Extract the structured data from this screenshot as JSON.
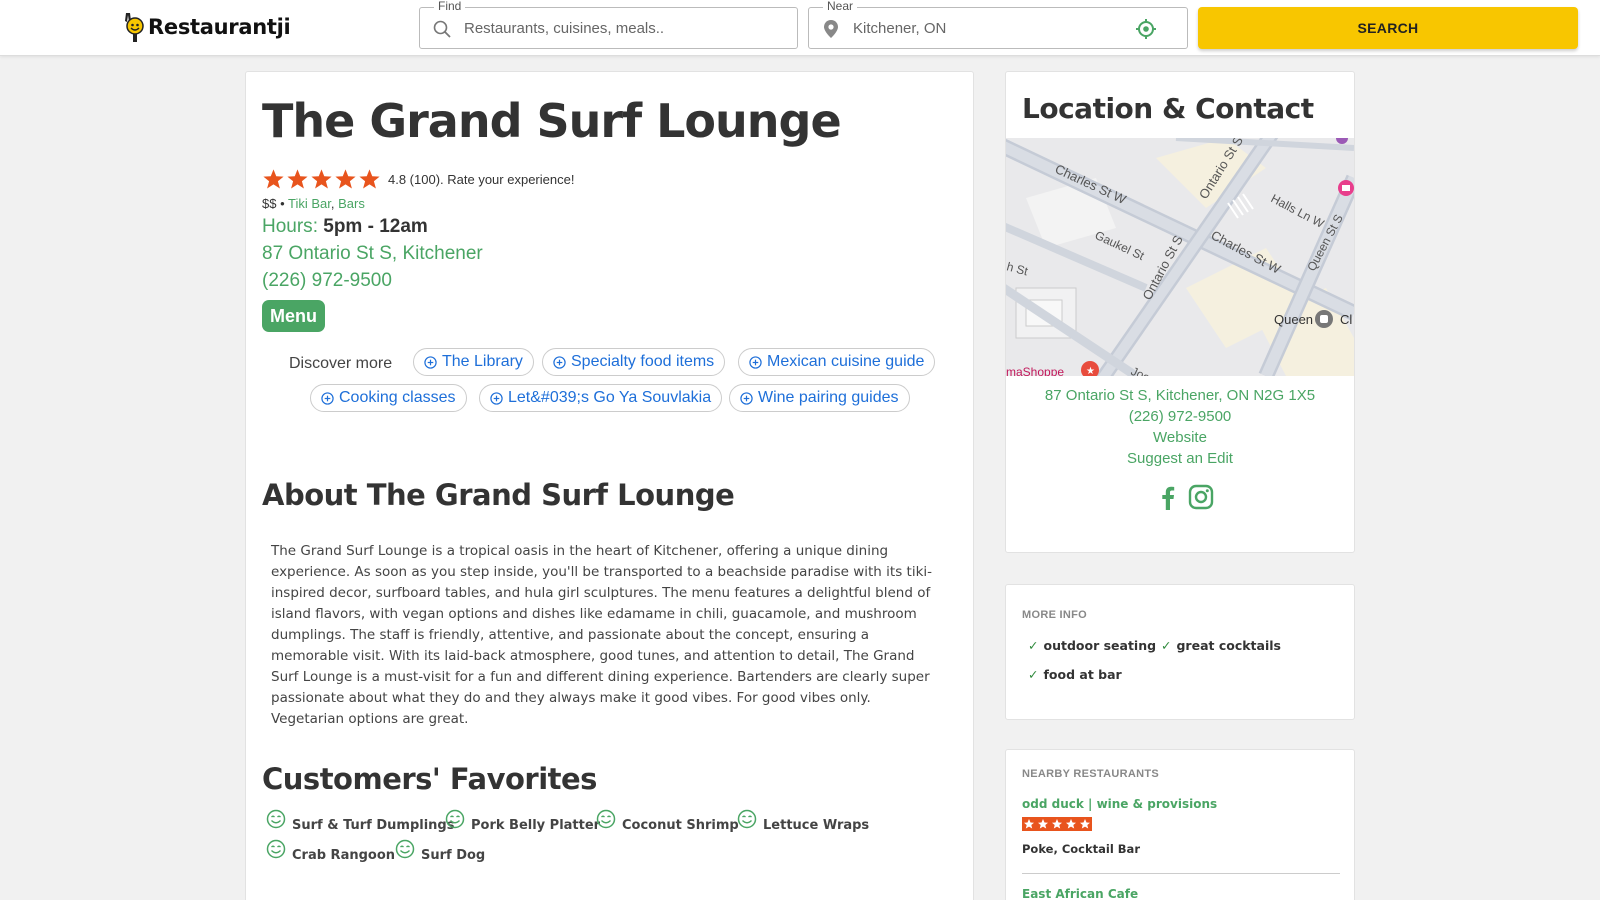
{
  "header": {
    "logo_text": "Restaurantji",
    "find_label": "Find",
    "find_placeholder": "Restaurants, cuisines, meals..",
    "near_label": "Near",
    "near_value": "Kitchener, ON",
    "search_label": "SEARCH"
  },
  "restaurant": {
    "name": "The Grand Surf Lounge",
    "rating": 4.8,
    "rating_text": "4.8 (100). Rate your experience!",
    "price": "$$",
    "separator": " • ",
    "categories": [
      "Tiki Bar",
      "Bars"
    ],
    "hours_label": "Hours",
    "hours_value": "5pm - 12am",
    "address": "87 Ontario St S, Kitchener",
    "phone": "(226) 972-9500",
    "menu_label": "Menu"
  },
  "discover": {
    "label": "Discover more",
    "chips": [
      "The Library",
      "Specialty food items",
      "Mexican cuisine guide",
      "Cooking classes",
      "Let&#039;s Go Ya Souvlakia",
      "Wine pairing guides"
    ]
  },
  "about": {
    "heading": "About The Grand Surf Lounge",
    "text": "The Grand Surf Lounge is a tropical oasis in the heart of Kitchener, offering a unique dining experience. As soon as you step inside, you'll be transported to a beachside paradise with its tiki-inspired decor, surfboard tables, and hula girl sculptures. The menu features a delightful blend of island flavors, with vegan options and dishes like edamame in chili, guacamole, and mushroom dumplings. The staff is friendly, attentive, and passionate about the concept, ensuring a memorable visit. With its laid-back atmosphere, good tunes, and attention to detail, The Grand Surf Lounge is a must-visit for a fun and different dining experience. Bartenders are clearly super passionate about what they do and they always make it good vibes. For good vibes only. Vegetarian options are great."
  },
  "favorites": {
    "heading": "Customers' Favorites",
    "items": [
      "Surf & Turf Dumplings",
      "Pork Belly Platter",
      "Coconut Shrimp",
      "Lettuce Wraps",
      "Crab Rangoon",
      "Surf Dog"
    ]
  },
  "location": {
    "heading": "Location & Contact",
    "map_labels": [
      "Charles St W",
      "Ontario St S",
      "Halls Ln W",
      "Queen St S",
      "Gaukel St",
      "Charles St W",
      "Ontario St S",
      "h St",
      "Queen",
      "Cl",
      "maShoppe",
      "Joe"
    ],
    "full_address": "87 Ontario St S, Kitchener, ON N2G 1X5",
    "phone": "(226) 972-9500",
    "website": "Website",
    "suggest": "Suggest an Edit"
  },
  "more_info": {
    "label": "MORE INFO",
    "check": "✓",
    "tags": [
      "outdoor seating",
      "great cocktails",
      "food at bar"
    ]
  },
  "nearby": {
    "label": "NEARBY RESTAURANTS",
    "items": [
      {
        "name": "odd duck | wine & provisions",
        "rating": 5,
        "categories": "Poke, Cocktail Bar"
      },
      {
        "name": "East African Cafe"
      }
    ]
  },
  "colors": {
    "accent_green": "#4aa564",
    "search_yellow": "#f8c600",
    "star_orange": "#e8541d",
    "link_blue": "#1e6fd9"
  }
}
